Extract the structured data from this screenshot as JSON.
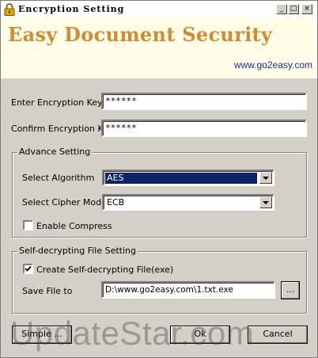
{
  "window": {
    "title": "Encryption Setting",
    "minimize": "_",
    "maximize": "□",
    "close": "×"
  },
  "banner": {
    "title": "Easy Document Security",
    "url": "www.go2easy.com"
  },
  "key": {
    "enter_label": "Enter Encryption Key",
    "enter_value": "******",
    "confirm_label": "Confirm Encryption Key",
    "confirm_value": "******"
  },
  "advance": {
    "group_label": "Advance Setting",
    "algorithm_label": "Select Algorithm",
    "algorithm_value": "AES",
    "cipher_label": "Select Cipher Mode:",
    "cipher_value": "ECB",
    "compress_label": "Enable Compress",
    "compress_checked": false
  },
  "selfdecrypt": {
    "group_label": "Self-decrypting File Setting",
    "create_label": "Create Self-decrypting File(exe)",
    "create_checked": true,
    "save_label": "Save File to",
    "save_value": "D:\\www.go2easy.com\\1.txt.exe",
    "browse_label": "..."
  },
  "buttons": {
    "simple": "Simple ...",
    "ok": "Ok",
    "cancel": "Cancel"
  },
  "watermark": "UpdateStar.com"
}
